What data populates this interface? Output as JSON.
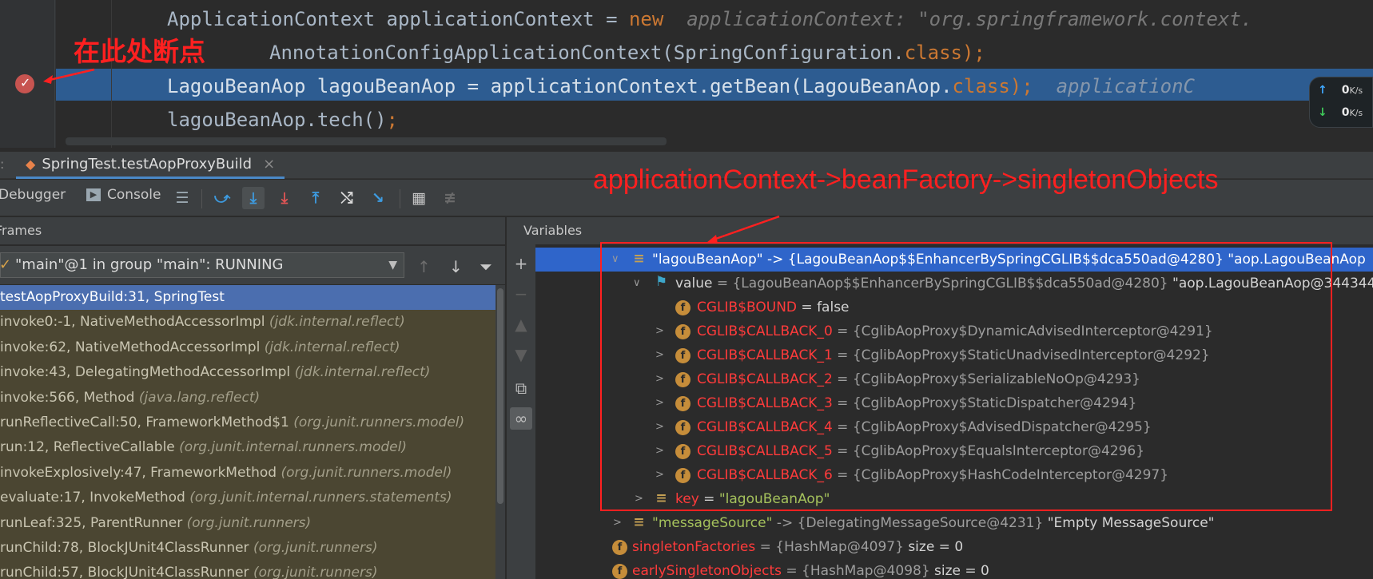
{
  "editor": {
    "line1_code": "ApplicationContext applicationContext = ",
    "line1_kw": "new",
    "line1_hint": "applicationContext: \"org.springframework.context.",
    "line2_code": "AnnotationConfigApplicationContext(SpringConfiguration.",
    "line2_kw": "class",
    "line2_end": ");",
    "line3_code": "LagouBeanAop lagouBeanAop = applicationContext.getBean(LagouBeanAop.",
    "line3_kw": "class",
    "line3_end": ");",
    "line3_hint": "applicationC",
    "line4_code": "lagouBeanAop.tech()",
    "line4_end": ";"
  },
  "annotations": {
    "breakpoint_note": "在此处断点",
    "path_note": "applicationContext->beanFactory->singletonObjects"
  },
  "network": {
    "up_value": "0",
    "up_unit": "K/s",
    "down_value": "0",
    "down_unit": "K/s"
  },
  "run_tab": {
    "label": "SpringTest.testAopProxyBuild",
    "close": "×"
  },
  "toolbar": {
    "debugger_label": "Debugger",
    "console_label": "Console"
  },
  "frames": {
    "header": "Frames",
    "thread": "\"main\"@1 in group \"main\": RUNNING",
    "items": [
      {
        "method": "testAopProxyBuild:31, SpringTest",
        "pkg": ""
      },
      {
        "method": "invoke0:-1, NativeMethodAccessorImpl ",
        "pkg": "(jdk.internal.reflect)"
      },
      {
        "method": "invoke:62, NativeMethodAccessorImpl ",
        "pkg": "(jdk.internal.reflect)"
      },
      {
        "method": "invoke:43, DelegatingMethodAccessorImpl ",
        "pkg": "(jdk.internal.reflect)"
      },
      {
        "method": "invoke:566, Method ",
        "pkg": "(java.lang.reflect)"
      },
      {
        "method": "runReflectiveCall:50, FrameworkMethod$1 ",
        "pkg": "(org.junit.runners.model)"
      },
      {
        "method": "run:12, ReflectiveCallable ",
        "pkg": "(org.junit.internal.runners.model)"
      },
      {
        "method": "invokeExplosively:47, FrameworkMethod ",
        "pkg": "(org.junit.runners.model)"
      },
      {
        "method": "evaluate:17, InvokeMethod ",
        "pkg": "(org.junit.internal.runners.statements)"
      },
      {
        "method": "runLeaf:325, ParentRunner ",
        "pkg": "(org.junit.runners)"
      },
      {
        "method": "runChild:78, BlockJUnit4ClassRunner ",
        "pkg": "(org.junit.runners)"
      },
      {
        "method": "runChild:57, BlockJUnit4ClassRunner ",
        "pkg": "(org.junit.runners)"
      }
    ]
  },
  "variables": {
    "header": "Variables",
    "rows": {
      "r0_name": "\"lagouBeanAop\"",
      "r0_val": " -> {LagouBeanAop$$EnhancerBySpringCGLIB$$dca550ad@4280} ",
      "r0_str": "\"aop.LagouBeanAop",
      "r1_name": "value",
      "r1_val": " = {LagouBeanAop$$EnhancerBySpringCGLIB$$dca550ad@4280} ",
      "r1_str": "\"aop.LagouBeanAop@344344",
      "r2_name": "CGLIB$BOUND",
      "r2_val": " = false",
      "cb": [
        {
          "name": "CGLIB$CALLBACK_0",
          "val": " = {CglibAopProxy$DynamicAdvisedInterceptor@4291}"
        },
        {
          "name": "CGLIB$CALLBACK_1",
          "val": " = {CglibAopProxy$StaticUnadvisedInterceptor@4292}"
        },
        {
          "name": "CGLIB$CALLBACK_2",
          "val": " = {CglibAopProxy$SerializableNoOp@4293}"
        },
        {
          "name": "CGLIB$CALLBACK_3",
          "val": " = {CglibAopProxy$StaticDispatcher@4294}"
        },
        {
          "name": "CGLIB$CALLBACK_4",
          "val": " = {CglibAopProxy$AdvisedDispatcher@4295}"
        },
        {
          "name": "CGLIB$CALLBACK_5",
          "val": " = {CglibAopProxy$EqualsInterceptor@4296}"
        },
        {
          "name": "CGLIB$CALLBACK_6",
          "val": " = {CglibAopProxy$HashCodeInterceptor@4297}"
        }
      ],
      "key_name": "key",
      "key_eq": " = ",
      "key_val": "\"lagouBeanAop\"",
      "ms_name": "\"messageSource\"",
      "ms_val": " -> {DelegatingMessageSource@4231} ",
      "ms_str": "\"Empty MessageSource\"",
      "sf_name": "singletonFactories",
      "sf_val": " = {HashMap@4097} ",
      "sf_size": " size = 0",
      "es_name": "earlySingletonObjects",
      "es_val": " = {HashMap@4098} ",
      "es_size": " size = 0"
    }
  }
}
